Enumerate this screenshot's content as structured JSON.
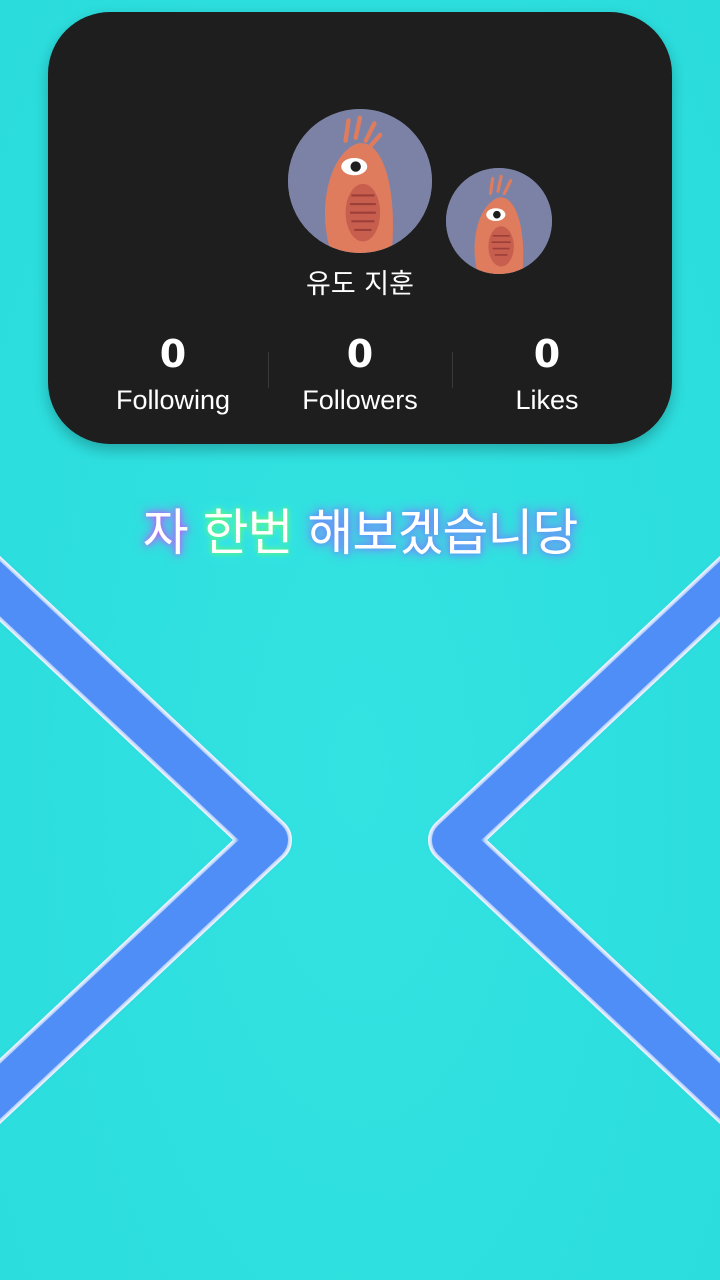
{
  "profile": {
    "display_name": "유도 지훈",
    "stats": [
      {
        "value": "0",
        "label": "Following"
      },
      {
        "value": "0",
        "label": "Followers"
      },
      {
        "value": "0",
        "label": "Likes"
      }
    ]
  },
  "caption": {
    "parts": [
      "자 ",
      "한번 ",
      "해보겠습니당"
    ]
  },
  "colors": {
    "background": "#2edfdf",
    "card": "#1e1e1f",
    "chevron": "#4f8ef7",
    "chevron_outline": "#ffffff",
    "avatar_bg": "#7b82a6"
  },
  "icons": {
    "avatar_main": "shrimp-avatar-icon",
    "avatar_secondary": "shrimp-avatar-icon",
    "left_arrow": "chevron-right-icon",
    "right_arrow": "chevron-left-icon"
  }
}
